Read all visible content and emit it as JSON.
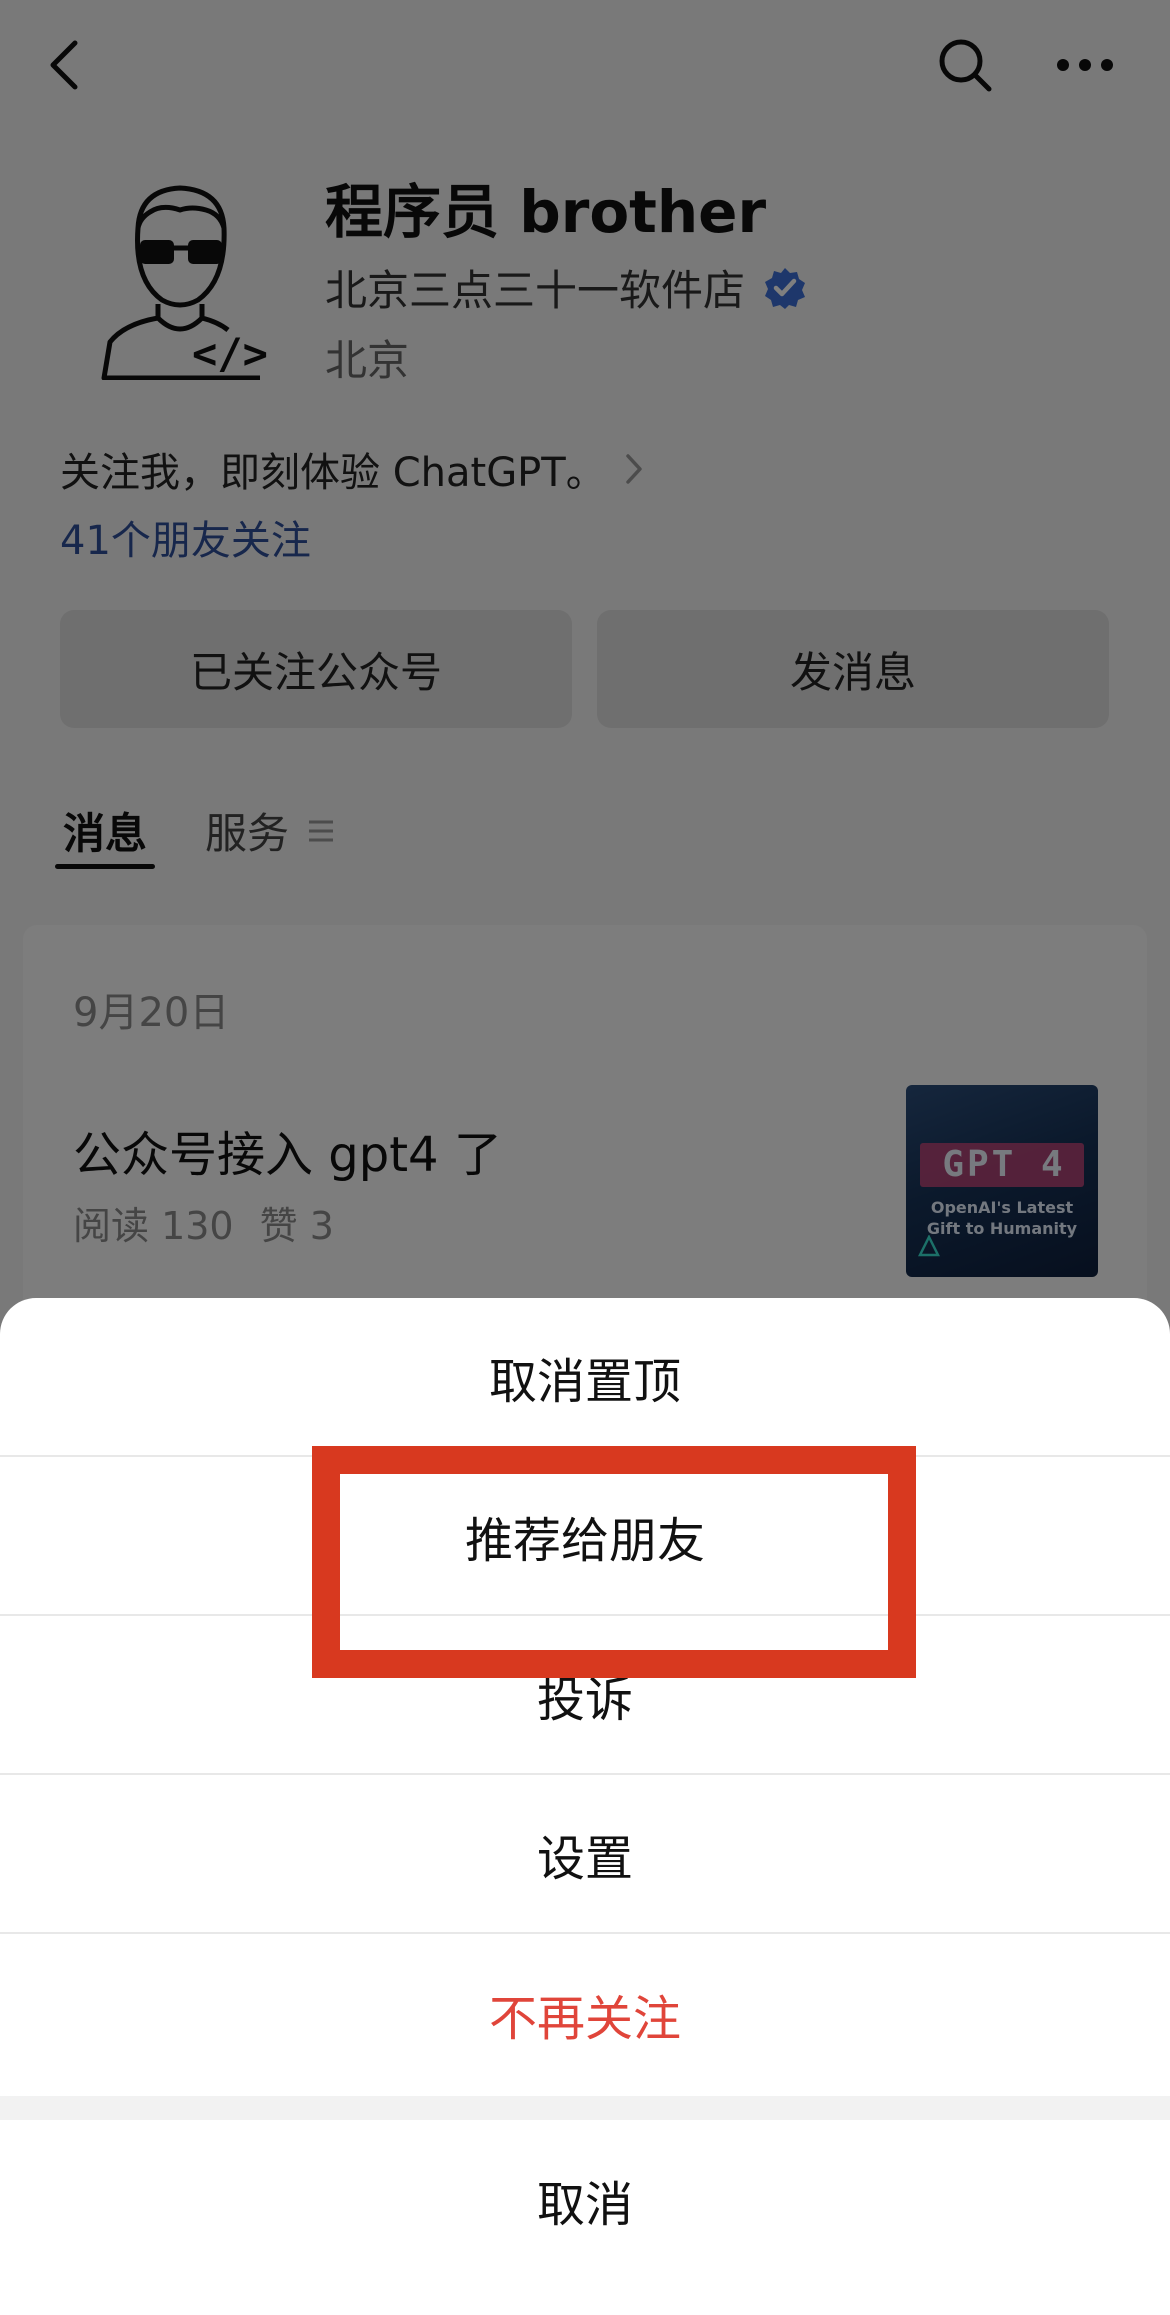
{
  "header": {
    "back_icon": "chevron-left-icon",
    "search_icon": "search-icon",
    "more_icon": "more-dots-icon"
  },
  "profile": {
    "name": "程序员 brother",
    "organization": "北京三点三十一软件店",
    "verified_icon": "verified-badge-icon",
    "location": "北京",
    "intro": "关注我，即刻体验 ChatGPT。",
    "friends_following": "41个朋友关注"
  },
  "actions": {
    "follow_label": "已关注公众号",
    "message_label": "发消息"
  },
  "tabs": {
    "messages": "消息",
    "services": "服务"
  },
  "article": {
    "date": "9月20日",
    "title": "公众号接入 gpt4 了",
    "reads": "阅读 130",
    "likes": "赞 3",
    "thumb_title": "GPT 4",
    "thumb_subtitle_1": "OpenAI's Latest",
    "thumb_subtitle_2": "Gift to Humanity"
  },
  "sheet": {
    "unpin": "取消置顶",
    "recommend": "推荐给朋友",
    "report": "投诉",
    "settings": "设置",
    "unfollow": "不再关注",
    "cancel": "取消"
  },
  "colors": {
    "danger": "#e0453a",
    "highlight": "#d8391f",
    "link": "#2f4e99",
    "verified": "#3d6fd6"
  }
}
